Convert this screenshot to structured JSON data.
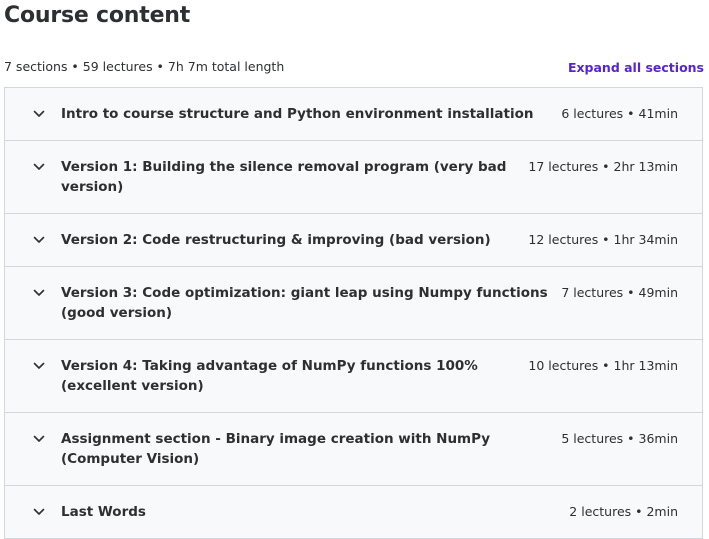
{
  "header": {
    "title": "Course content",
    "summary": "7 sections • 59 lectures • 7h 7m total length",
    "expand_all_label": "Expand all sections"
  },
  "icons": {
    "section_toggle": "chevron-down-icon"
  },
  "colors": {
    "accent": "#5624d0",
    "text": "#2d2f31",
    "section_bg": "#f7f9fa",
    "border": "#d1d7dc"
  },
  "sections": [
    {
      "title": "Intro to course structure and Python environment installation",
      "meta": "6 lectures • 41min"
    },
    {
      "title": "Version 1: Building the silence removal program (very bad version)",
      "meta": "17 lectures • 2hr 13min"
    },
    {
      "title": "Version 2: Code restructuring & improving (bad version)",
      "meta": "12 lectures • 1hr 34min"
    },
    {
      "title": "Version 3: Code optimization: giant leap using Numpy functions (good version)",
      "meta": "7 lectures • 49min"
    },
    {
      "title": "Version 4: Taking advantage of NumPy functions 100% (excellent version)",
      "meta": "10 lectures • 1hr 13min"
    },
    {
      "title": "Assignment section - Binary image creation with NumPy (Computer Vision)",
      "meta": "5 lectures • 36min"
    },
    {
      "title": "Last Words",
      "meta": "2 lectures • 2min"
    }
  ]
}
